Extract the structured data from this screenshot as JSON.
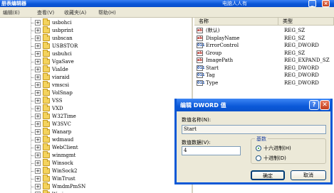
{
  "window": {
    "title": "册表编辑器",
    "watermark": "电脑人人有"
  },
  "menu": [
    "编辑(E)",
    "查看(V)",
    "收藏夹(A)",
    "帮助(H)"
  ],
  "tree": {
    "items": [
      "usbohci",
      "usbprint",
      "usbscan",
      "USBSTOR",
      "usbuhci",
      "VgaSave",
      "ViaIde",
      "viaraid",
      "vmscsi",
      "VolSnap",
      "VSS",
      "VXD",
      "W32Time",
      "W3SVC",
      "Wanarp",
      "wdmaud",
      "WebClient",
      "winmgmt",
      "Winsock",
      "WinSock2",
      "WinTrust",
      "WmdmPmSN",
      "Wmi"
    ]
  },
  "list": {
    "columns": [
      "名称",
      "类型"
    ],
    "rows": [
      {
        "name": "(默认)",
        "type": "REG_SZ",
        "icon": "string-value-icon"
      },
      {
        "name": "DisplayName",
        "type": "REG_SZ",
        "icon": "string-value-icon"
      },
      {
        "name": "ErrorControl",
        "type": "REG_DWORD",
        "icon": "binary-value-icon"
      },
      {
        "name": "Group",
        "type": "REG_SZ",
        "icon": "string-value-icon"
      },
      {
        "name": "ImagePath",
        "type": "REG_EXPAND_SZ",
        "icon": "string-value-icon"
      },
      {
        "name": "Start",
        "type": "REG_DWORD",
        "icon": "binary-value-icon"
      },
      {
        "name": "Tag",
        "type": "REG_DWORD",
        "icon": "binary-value-icon"
      },
      {
        "name": "Type",
        "type": "REG_DWORD",
        "icon": "binary-value-icon"
      }
    ]
  },
  "dialog": {
    "title": "编辑 DWORD 值",
    "name_label": "数值名称(N):",
    "name_value": "Start",
    "data_label": "数值数据(V):",
    "data_value": "4",
    "base_label": "基数",
    "hex_label": "十六进制(H)",
    "dec_label": "十进制(D)",
    "ok_label": "确定",
    "cancel_label": "取消",
    "help_glyph": "?",
    "close_glyph": "✕"
  }
}
